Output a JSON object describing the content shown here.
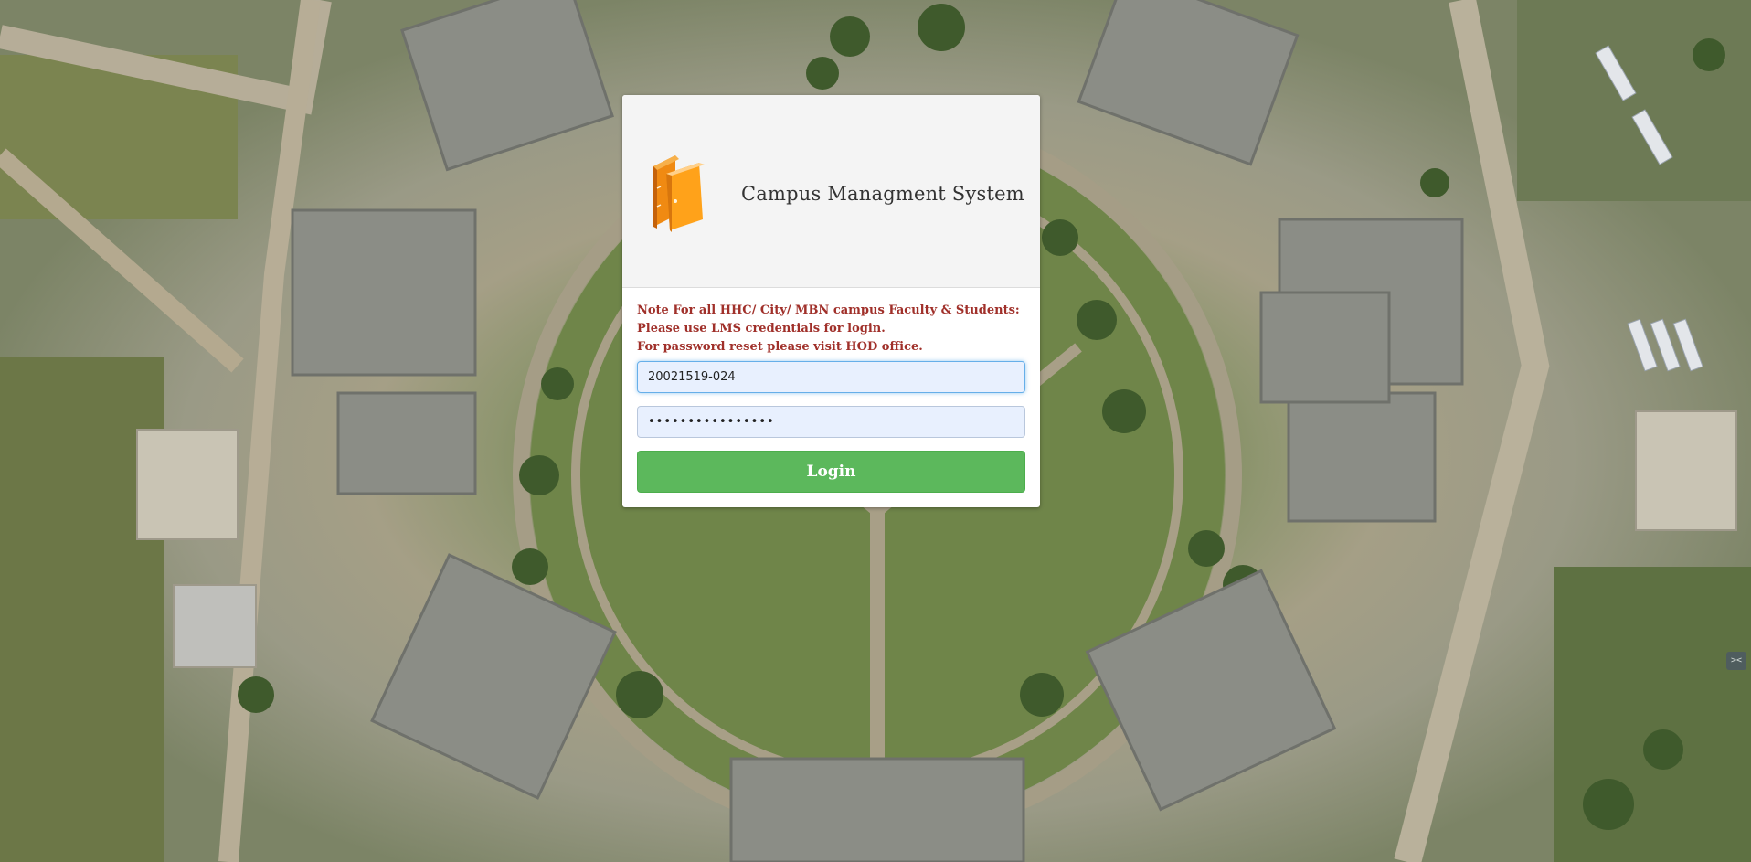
{
  "app": {
    "title": "Campus Managment System"
  },
  "notice": {
    "line1": "Note For all HHC/ City/ MBN campus Faculty & Students:",
    "line2": "Please use LMS credentials for login.",
    "line3": "For password reset please visit HOD office."
  },
  "form": {
    "username_value": "20021519-024",
    "password_value": "••••••••••••••••",
    "login_label": "Login"
  },
  "icons": {
    "logo": "books-icon",
    "side_widget": "expand-arrows-icon"
  },
  "colors": {
    "note_text": "#a0302a",
    "login_button": "#5cb85c",
    "input_autofill": "#e8f0fe",
    "header_bg": "#f4f4f4"
  }
}
